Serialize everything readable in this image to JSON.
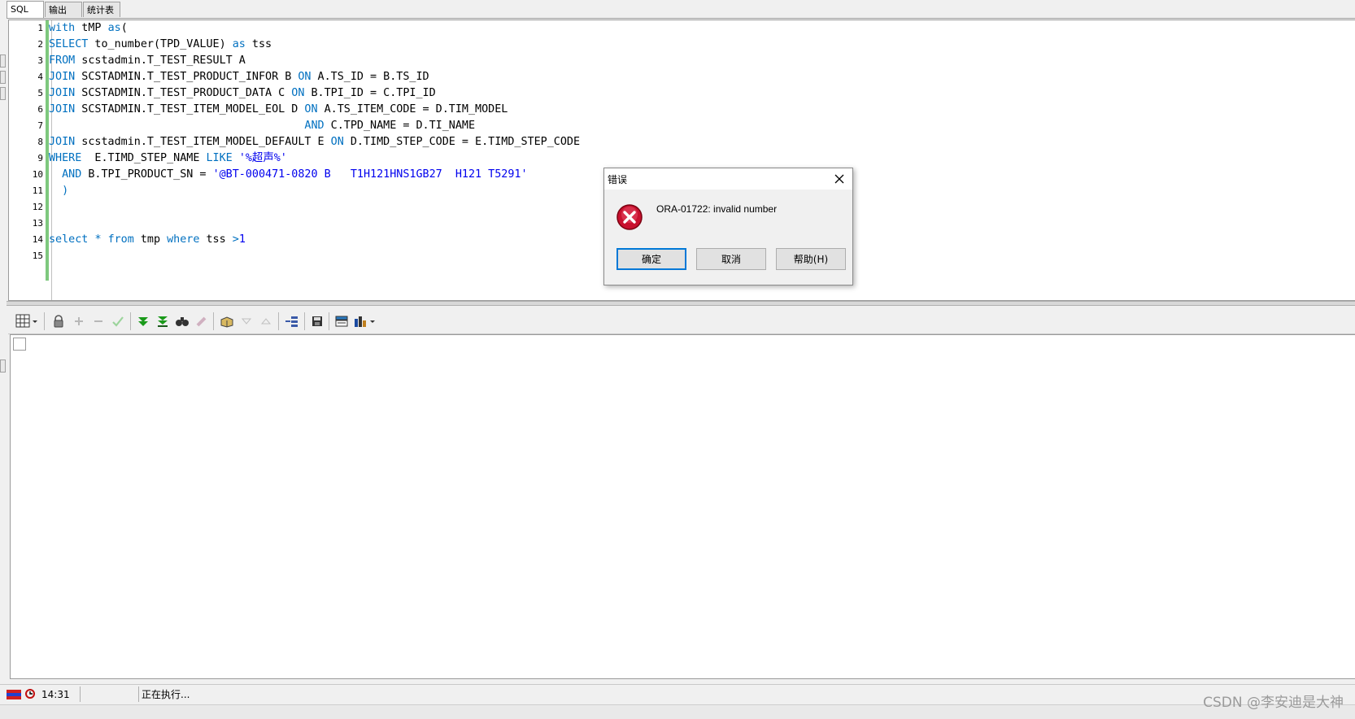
{
  "tabs": [
    {
      "label": "SQL",
      "active": true
    },
    {
      "label": "输出",
      "active": false
    },
    {
      "label": "统计表",
      "active": false
    }
  ],
  "editor": {
    "line_numbers": [
      "1",
      "2",
      "3",
      "4",
      "5",
      "6",
      "7",
      "8",
      "9",
      "10",
      "11",
      "12",
      "13",
      "14",
      "15"
    ],
    "colors": {
      "keyword": "#0070c0",
      "string": "#0000ee",
      "text": "#000000",
      "modified_marker": "#7ec87e"
    }
  },
  "results_toolbar": {
    "icons": [
      "grid-view-icon",
      "lock-icon",
      "add-record-icon",
      "delete-record-icon",
      "post-changes-icon",
      "fetch-next-page-icon",
      "fetch-last-page-icon",
      "find-icon",
      "clear-icon",
      "query-by-example-icon",
      "sort-descending-icon",
      "sort-ascending-icon",
      "export-icon",
      "save-icon",
      "single-record-view-icon",
      "chart-icon"
    ]
  },
  "status": {
    "time": "14:31",
    "message": "正在执行..."
  },
  "dialog": {
    "title": "错误",
    "message": "ORA-01722: invalid number",
    "ok": "确定",
    "cancel": "取消",
    "help": "帮助(H)"
  },
  "watermark": "CSDN @李安迪是大神"
}
